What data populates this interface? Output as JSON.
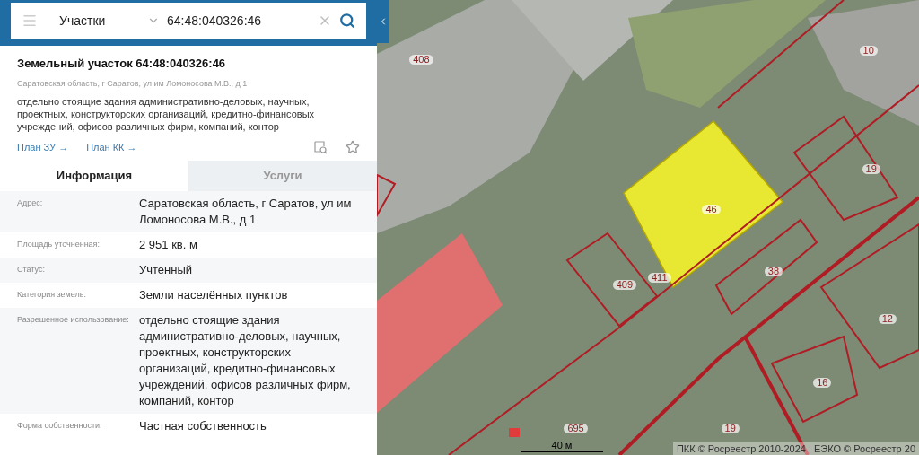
{
  "search": {
    "layer": "Участки",
    "value": "64:48:040326:46"
  },
  "card": {
    "title": "Земельный участок 64:48:040326:46",
    "address": "Саратовская область, г Саратов, ул им Ломоносова М.В., д 1",
    "description": "отдельно стоящие здания административно-деловых, научных, проектных, конструкторских организаций, кредитно-финансовых учреждений, офисов различных фирм, компаний, контор",
    "links": [
      "План ЗУ →",
      "План КК →"
    ],
    "favorite": false
  },
  "tabs": [
    {
      "label": "Информация",
      "selected": true
    },
    {
      "label": "Услуги",
      "selected": false
    }
  ],
  "info_rows": [
    {
      "label": "Адрес:",
      "value": "Саратовская область, г Саратов, ул им Ломоносова М.В., д 1"
    },
    {
      "label": "Площадь уточненная:",
      "value": "2 951 кв. м"
    },
    {
      "label": "Статус:",
      "value": "Учтенный"
    },
    {
      "label": "Категория земель:",
      "value": "Земли населённых пунктов"
    },
    {
      "label": "Разрешенное использование:",
      "value": "отдельно стоящие здания административно-деловых, научных, проектных, конструкторских организаций, кредитно-финансовых учреждений, офисов различных фирм, компаний, контор"
    },
    {
      "label": "Форма собственности:",
      "value": "Частная собственность"
    }
  ],
  "map": {
    "labels": [
      "408",
      "10",
      "19",
      "46",
      "409",
      "411",
      "38",
      "12",
      "16",
      "695",
      "19"
    ],
    "scale": "40 м",
    "attribution": "ПКК © Росреестр 2010-2024 | ЕЭКО © Росреестр 20"
  }
}
